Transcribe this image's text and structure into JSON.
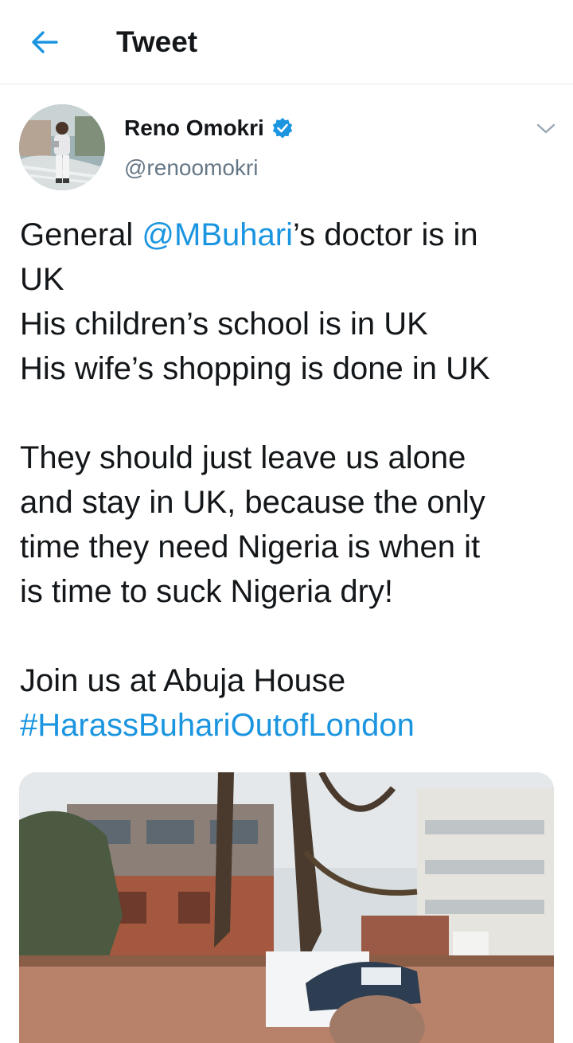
{
  "header": {
    "title": "Tweet",
    "back_icon": "back-arrow-icon"
  },
  "author": {
    "name": "Reno Omokri",
    "handle": "@renoomokri",
    "verified": true,
    "menu_icon": "chevron-down-icon"
  },
  "tweet": {
    "line1_pre": "General ",
    "line1_mention": "@MBuhari",
    "line1_post": "’s doctor is in",
    "line2": "UK",
    "line3": "His children’s school is in UK",
    "line4": "His wife’s shopping is done in UK",
    "line5": "They should just leave us alone",
    "line6": "and stay in UK, because the only",
    "line7": "time they need Nigeria is when it",
    "line8": "is time to suck Nigeria dry!",
    "line9": "Join us at Abuja House",
    "hashtag": "#HarassBuhariOutofLondon"
  },
  "colors": {
    "accent": "#1b95e0",
    "text": "#14171a",
    "secondary": "#657786",
    "divider": "#e1e8ed"
  }
}
